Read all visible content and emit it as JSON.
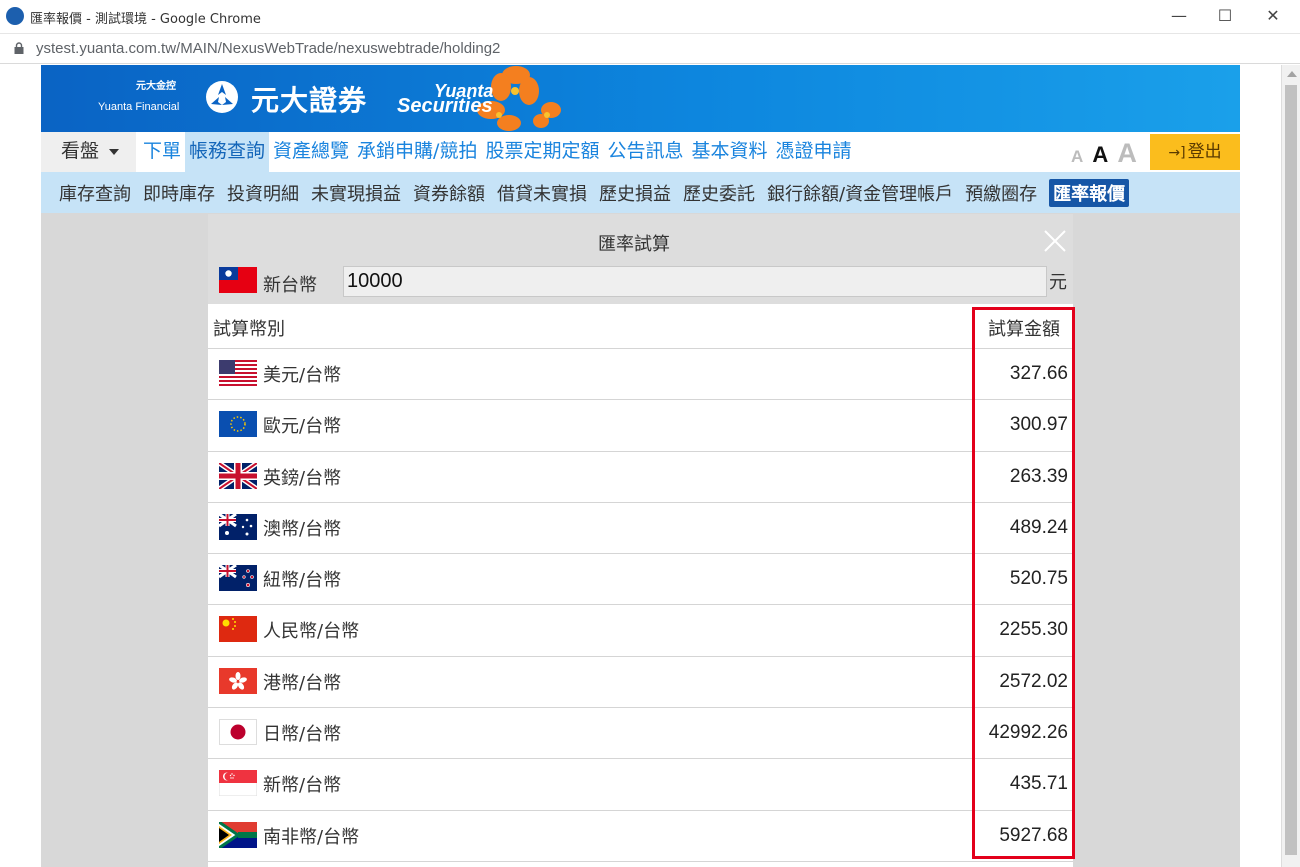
{
  "window": {
    "title": "匯率報價 - 測試環境 - Google Chrome",
    "url": "ystest.yuanta.com.tw/MAIN/NexusWebTrade/nexuswebtrade/holding2",
    "buttons": {
      "minimize": "—",
      "maximize": "☐",
      "close": "✕"
    }
  },
  "banner": {
    "financial_cn": "元大金控",
    "financial_en": "Yuanta Financial",
    "brand_cn": "元大證券",
    "brand_en_1": "Yuanta",
    "brand_en_2": "Securities"
  },
  "main_nav": {
    "watch_label": "看盤",
    "items": [
      {
        "label": "下單"
      },
      {
        "label": "帳務查詢"
      },
      {
        "label": "資產總覽"
      },
      {
        "label": "承銷申購/競拍"
      },
      {
        "label": "股票定期定額"
      },
      {
        "label": "公告訊息"
      },
      {
        "label": "基本資料"
      },
      {
        "label": "憑證申請"
      }
    ],
    "font_sizes": [
      "A",
      "A",
      "A"
    ],
    "logout_label": "登出",
    "logout_icon": "→]"
  },
  "sub_nav": {
    "items": [
      {
        "label": "庫存查詢"
      },
      {
        "label": "即時庫存"
      },
      {
        "label": "投資明細"
      },
      {
        "label": "未實現損益"
      },
      {
        "label": "資券餘額"
      },
      {
        "label": "借貸未實損"
      },
      {
        "label": "歷史損益"
      },
      {
        "label": "歷史委託"
      },
      {
        "label": "銀行餘額/資金管理帳戶"
      },
      {
        "label": "預繳圈存"
      },
      {
        "label": "匯率報價"
      }
    ]
  },
  "dialog": {
    "title": "匯率試算",
    "base_currency": "新台幣",
    "amount_value": "10000",
    "amount_unit": "元",
    "col_currency": "試算幣別",
    "col_amount": "試算金額",
    "rows": [
      {
        "name": "美元/台幣",
        "value": "327.66",
        "flag": "us-flag-icon"
      },
      {
        "name": "歐元/台幣",
        "value": "300.97",
        "flag": "eu-flag-icon"
      },
      {
        "name": "英鎊/台幣",
        "value": "263.39",
        "flag": "gb-flag-icon"
      },
      {
        "name": "澳幣/台幣",
        "value": "489.24",
        "flag": "au-flag-icon"
      },
      {
        "name": "紐幣/台幣",
        "value": "520.75",
        "flag": "nz-flag-icon"
      },
      {
        "name": "人民幣/台幣",
        "value": "2255.30",
        "flag": "cn-flag-icon"
      },
      {
        "name": "港幣/台幣",
        "value": "2572.02",
        "flag": "hk-flag-icon"
      },
      {
        "name": "日幣/台幣",
        "value": "42992.26",
        "flag": "jp-flag-icon"
      },
      {
        "name": "新幣/台幣",
        "value": "435.71",
        "flag": "sg-flag-icon"
      },
      {
        "name": "南非幣/台幣",
        "value": "5927.68",
        "flag": "za-flag-icon"
      }
    ]
  },
  "colors": {
    "brand_blue": "#0a63c4",
    "nav_link": "#1a84de",
    "subnav_bg": "#c6e3f7",
    "active_badge": "#1656a6",
    "logout": "#fbbd1d",
    "highlight": "#e3001b"
  }
}
